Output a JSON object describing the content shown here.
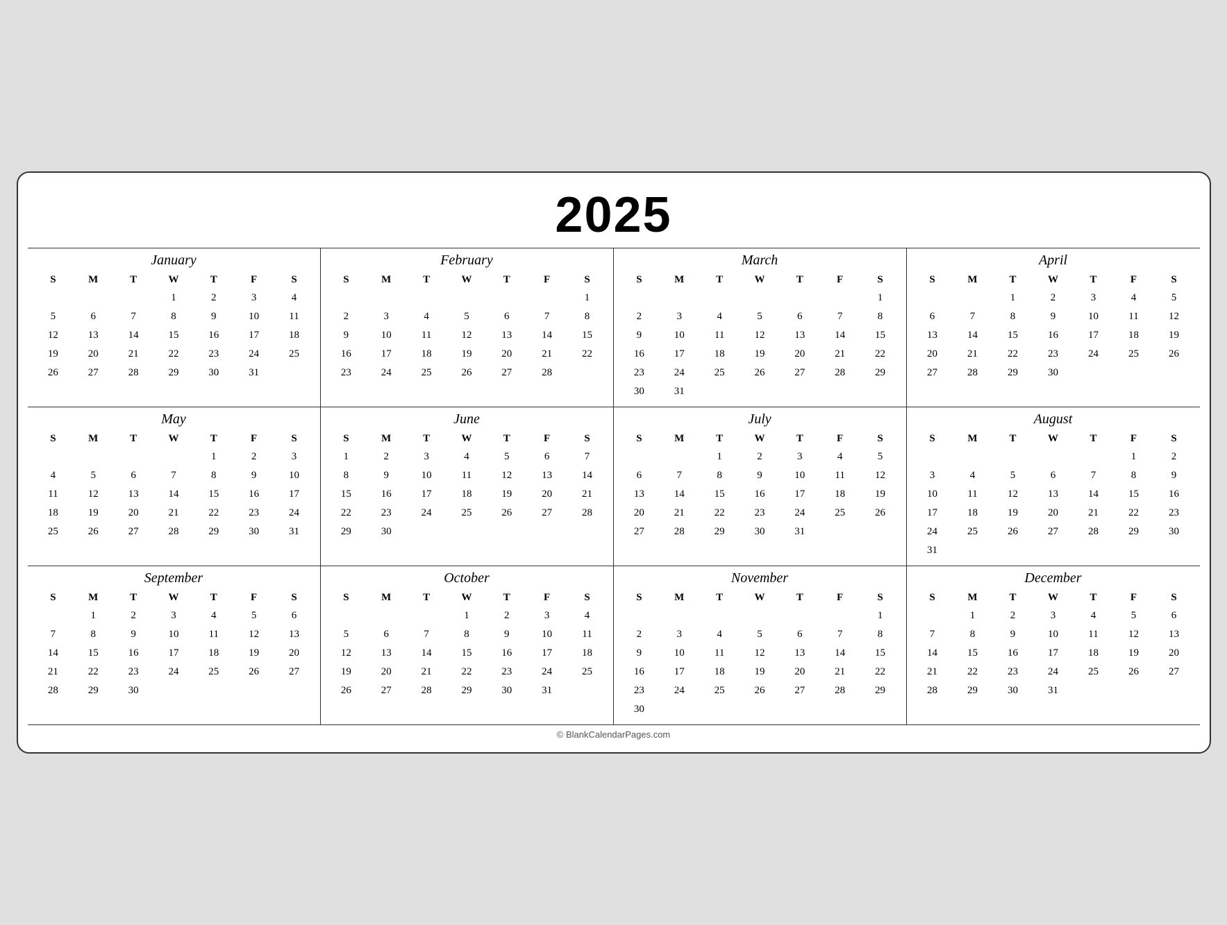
{
  "year": "2025",
  "footer": "© BlankCalendarPages.com",
  "months": [
    {
      "name": "January",
      "weeks": [
        [
          "",
          "",
          "",
          "1",
          "2",
          "3",
          "4"
        ],
        [
          "5",
          "6",
          "7",
          "8",
          "9",
          "10",
          "11"
        ],
        [
          "12",
          "13",
          "14",
          "15",
          "16",
          "17",
          "18"
        ],
        [
          "19",
          "20",
          "21",
          "22",
          "23",
          "24",
          "25"
        ],
        [
          "26",
          "27",
          "28",
          "29",
          "30",
          "31",
          ""
        ]
      ]
    },
    {
      "name": "February",
      "weeks": [
        [
          "",
          "",
          "",
          "",
          "",
          "",
          "1"
        ],
        [
          "2",
          "3",
          "4",
          "5",
          "6",
          "7",
          "8"
        ],
        [
          "9",
          "10",
          "11",
          "12",
          "13",
          "14",
          "15"
        ],
        [
          "16",
          "17",
          "18",
          "19",
          "20",
          "21",
          "22"
        ],
        [
          "23",
          "24",
          "25",
          "26",
          "27",
          "28",
          ""
        ]
      ]
    },
    {
      "name": "March",
      "weeks": [
        [
          "",
          "",
          "",
          "",
          "",
          "",
          "1"
        ],
        [
          "2",
          "3",
          "4",
          "5",
          "6",
          "7",
          "8"
        ],
        [
          "9",
          "10",
          "11",
          "12",
          "13",
          "14",
          "15"
        ],
        [
          "16",
          "17",
          "18",
          "19",
          "20",
          "21",
          "22"
        ],
        [
          "23",
          "24",
          "25",
          "26",
          "27",
          "28",
          "29"
        ],
        [
          "30",
          "31",
          "",
          "",
          "",
          "",
          ""
        ]
      ]
    },
    {
      "name": "April",
      "weeks": [
        [
          "",
          "",
          "1",
          "2",
          "3",
          "4",
          "5"
        ],
        [
          "6",
          "7",
          "8",
          "9",
          "10",
          "11",
          "12"
        ],
        [
          "13",
          "14",
          "15",
          "16",
          "17",
          "18",
          "19"
        ],
        [
          "20",
          "21",
          "22",
          "23",
          "24",
          "25",
          "26"
        ],
        [
          "27",
          "28",
          "29",
          "30",
          "",
          "",
          ""
        ]
      ]
    },
    {
      "name": "May",
      "weeks": [
        [
          "",
          "",
          "",
          "",
          "1",
          "2",
          "3"
        ],
        [
          "4",
          "5",
          "6",
          "7",
          "8",
          "9",
          "10"
        ],
        [
          "11",
          "12",
          "13",
          "14",
          "15",
          "16",
          "17"
        ],
        [
          "18",
          "19",
          "20",
          "21",
          "22",
          "23",
          "24"
        ],
        [
          "25",
          "26",
          "27",
          "28",
          "29",
          "30",
          "31"
        ]
      ]
    },
    {
      "name": "June",
      "weeks": [
        [
          "1",
          "2",
          "3",
          "4",
          "5",
          "6",
          "7"
        ],
        [
          "8",
          "9",
          "10",
          "11",
          "12",
          "13",
          "14"
        ],
        [
          "15",
          "16",
          "17",
          "18",
          "19",
          "20",
          "21"
        ],
        [
          "22",
          "23",
          "24",
          "25",
          "26",
          "27",
          "28"
        ],
        [
          "29",
          "30",
          "",
          "",
          "",
          "",
          ""
        ]
      ]
    },
    {
      "name": "July",
      "weeks": [
        [
          "",
          "",
          "1",
          "2",
          "3",
          "4",
          "5"
        ],
        [
          "6",
          "7",
          "8",
          "9",
          "10",
          "11",
          "12"
        ],
        [
          "13",
          "14",
          "15",
          "16",
          "17",
          "18",
          "19"
        ],
        [
          "20",
          "21",
          "22",
          "23",
          "24",
          "25",
          "26"
        ],
        [
          "27",
          "28",
          "29",
          "30",
          "31",
          "",
          ""
        ]
      ]
    },
    {
      "name": "August",
      "weeks": [
        [
          "",
          "",
          "",
          "",
          "",
          "1",
          "2"
        ],
        [
          "3",
          "4",
          "5",
          "6",
          "7",
          "8",
          "9"
        ],
        [
          "10",
          "11",
          "12",
          "13",
          "14",
          "15",
          "16"
        ],
        [
          "17",
          "18",
          "19",
          "20",
          "21",
          "22",
          "23"
        ],
        [
          "24",
          "25",
          "26",
          "27",
          "28",
          "29",
          "30"
        ],
        [
          "31",
          "",
          "",
          "",
          "",
          "",
          ""
        ]
      ]
    },
    {
      "name": "September",
      "weeks": [
        [
          "",
          "1",
          "2",
          "3",
          "4",
          "5",
          "6"
        ],
        [
          "7",
          "8",
          "9",
          "10",
          "11",
          "12",
          "13"
        ],
        [
          "14",
          "15",
          "16",
          "17",
          "18",
          "19",
          "20"
        ],
        [
          "21",
          "22",
          "23",
          "24",
          "25",
          "26",
          "27"
        ],
        [
          "28",
          "29",
          "30",
          "",
          "",
          "",
          ""
        ]
      ]
    },
    {
      "name": "October",
      "weeks": [
        [
          "",
          "",
          "",
          "1",
          "2",
          "3",
          "4"
        ],
        [
          "5",
          "6",
          "7",
          "8",
          "9",
          "10",
          "11"
        ],
        [
          "12",
          "13",
          "14",
          "15",
          "16",
          "17",
          "18"
        ],
        [
          "19",
          "20",
          "21",
          "22",
          "23",
          "24",
          "25"
        ],
        [
          "26",
          "27",
          "28",
          "29",
          "30",
          "31",
          ""
        ]
      ]
    },
    {
      "name": "November",
      "weeks": [
        [
          "",
          "",
          "",
          "",
          "",
          "",
          "1"
        ],
        [
          "2",
          "3",
          "4",
          "5",
          "6",
          "7",
          "8"
        ],
        [
          "9",
          "10",
          "11",
          "12",
          "13",
          "14",
          "15"
        ],
        [
          "16",
          "17",
          "18",
          "19",
          "20",
          "21",
          "22"
        ],
        [
          "23",
          "24",
          "25",
          "26",
          "27",
          "28",
          "29"
        ],
        [
          "30",
          "",
          "",
          "",
          "",
          "",
          ""
        ]
      ]
    },
    {
      "name": "December",
      "weeks": [
        [
          "",
          "1",
          "2",
          "3",
          "4",
          "5",
          "6"
        ],
        [
          "7",
          "8",
          "9",
          "10",
          "11",
          "12",
          "13"
        ],
        [
          "14",
          "15",
          "16",
          "17",
          "18",
          "19",
          "20"
        ],
        [
          "21",
          "22",
          "23",
          "24",
          "25",
          "26",
          "27"
        ],
        [
          "28",
          "29",
          "30",
          "31",
          "",
          "",
          ""
        ]
      ]
    }
  ],
  "dayHeaders": [
    "S",
    "M",
    "T",
    "W",
    "T",
    "F",
    "S"
  ]
}
